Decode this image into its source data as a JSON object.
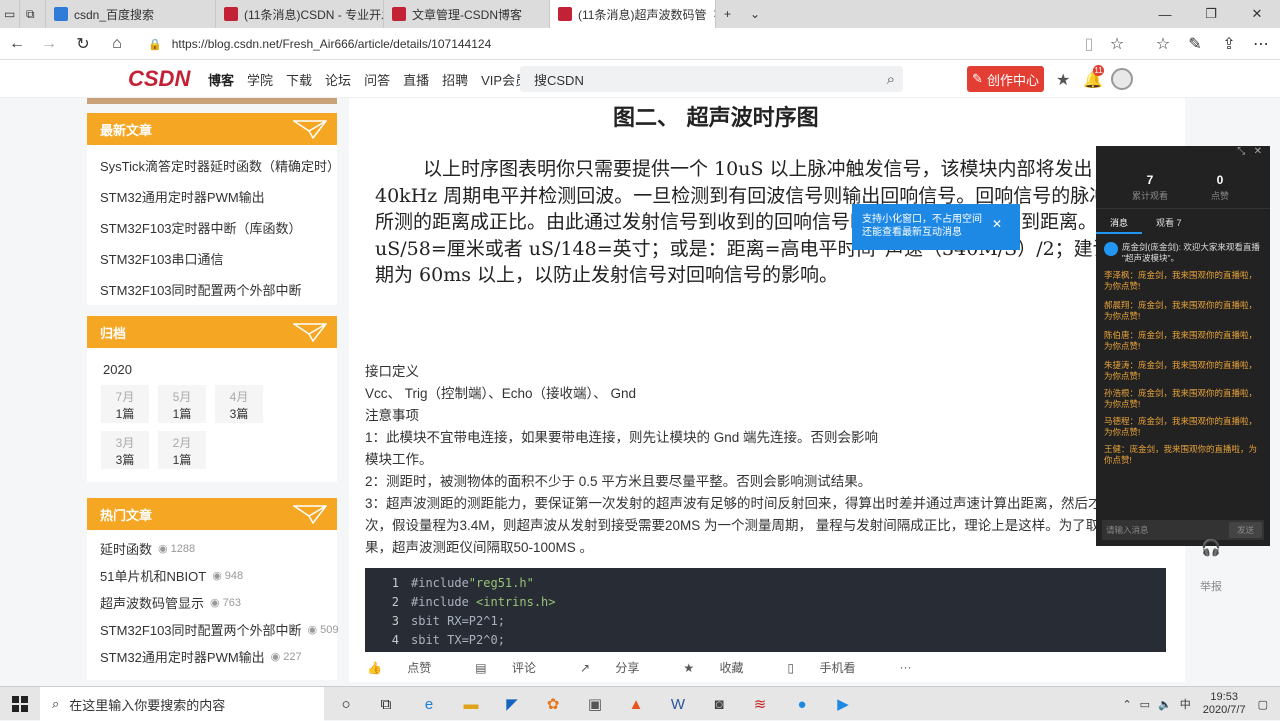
{
  "browser": {
    "tabs": [
      {
        "label": "csdn_百度搜索",
        "icon": "baidu"
      },
      {
        "label": "(11条消息)CSDN - 专业开发",
        "icon": "csdn"
      },
      {
        "label": "文章管理-CSDN博客",
        "icon": "csdn"
      },
      {
        "label": "(11条消息)超声波数码管",
        "icon": "csdn"
      }
    ],
    "url": "https://blog.csdn.net/Fresh_Air666/article/details/107144124"
  },
  "header": {
    "logo": "CSDN",
    "nav": [
      "博客",
      "学院",
      "下载",
      "论坛",
      "问答",
      "直播",
      "招聘",
      "VIP会员"
    ],
    "search_text": "搜CSDN",
    "create_label": "创作中心",
    "notif_count": "11",
    "accent": "#c32136"
  },
  "sidebar": {
    "latest_title": "最新文章",
    "latest": [
      "SysTick滴答定时器延时函数（精确定时）",
      "STM32通用定时器PWM输出",
      "STM32F103定时器中断（库函数）",
      "STM32F103串口通信",
      "STM32F103同时配置两个外部中断"
    ],
    "archive_title": "归档",
    "archive_year": "2020",
    "archive": [
      {
        "m": "7月",
        "c": "1篇"
      },
      {
        "m": "5月",
        "c": "1篇"
      },
      {
        "m": "4月",
        "c": "3篇"
      },
      {
        "m": "3月",
        "c": "3篇"
      },
      {
        "m": "2月",
        "c": "1篇"
      }
    ],
    "hot_title": "热门文章",
    "hot": [
      {
        "t": "延时函数",
        "v": "1288"
      },
      {
        "t": "51单片机和NBIOT",
        "v": "948"
      },
      {
        "t": "超声波数码管显示",
        "v": "763"
      },
      {
        "t": "STM32F103同时配置两个外部中断",
        "v": "509"
      },
      {
        "t": "STM32通用定时器PWM输出",
        "v": "227"
      }
    ]
  },
  "article": {
    "fig_title": "图二、 超声波时序图",
    "fig_para": "以上时序图表明你只需要提供一个 10uS 以上脉冲触发信号，该模块内部将发出 8 个 40kHz 周期电平并检测回波。一旦检测到有回波信号则输出回响信号。回响信号的脉冲宽度与所测的距离成正比。由此通过发射信号到收到的回响信号时间间隔可以计算得到距离。公式：uS/58=厘米或者 uS/148=英寸；或是：距离=高电平时间*声速（340M/S）/2；建议测量周期为 60ms 以上，以防止发射信号对回响信号的影响。",
    "lines": [
      "接口定义",
      "Vcc、 Trig（控制端）、Echo（接收端）、 Gnd",
      "注意事项",
      "1：此模块不宜带电连接，如果要带电连接，则先让模块的 Gnd 端先连接。否则会影响",
      "模块工作。",
      "2：测距时，被测物体的面积不少于 0.5 平方米且要尽量平整。否则会影响测试结果。",
      "3：超声波测距的测距能力，要保证第一次发射的超声波有足够的时间反射回来，得算出时差并通过声速计算出距离，然后才能",
      "次，假设量程为3.4M，则超声波从发射到接受需要20MS 为一个测量周期， 量程与发射间隔成正比，理论上是这样。为了取得",
      "果，超声波测距仪间隔取50-100MS 。"
    ],
    "code": [
      {
        "n": "1",
        "pre": "#include",
        "str": "\"reg51.h\""
      },
      {
        "n": "2",
        "pre": "#include ",
        "str": "<intrins.h>"
      },
      {
        "n": "3",
        "pre": "sbit RX=P2^1;",
        "str": ""
      },
      {
        "n": "4",
        "pre": "sbit TX=P2^0;",
        "str": ""
      }
    ]
  },
  "toolbar": [
    "点赞",
    "评论",
    "分享",
    "收藏",
    "手机看",
    "···"
  ],
  "tooltip": {
    "text": "支持小化窗口，不占用空间还能查看最新互动消息"
  },
  "live": {
    "views": "7",
    "views_label": "累计观看",
    "likes": "0",
    "likes_label": "点赞",
    "tab_msg": "消息",
    "tab_viewers": "观看 7",
    "system_msg": "庞金剑(庞金剑): 欢迎大家来观看直播 \"超声波模块\"。",
    "messages": [
      "李泽枫：庞金剑，我来围观你的直播啦，为你点赞!",
      "郝晨翔：庞金剑，我来围观你的直播啦，为你点赞!",
      "陈伯唐：庞金剑，我来围观你的直播啦，为你点赞!",
      "朱捷涛：庞金剑，我来围观你的直播啦，为你点赞!",
      "孙浩根：庞金剑，我来围观你的直播啦，为你点赞!",
      "马德程：庞金剑，我来围观你的直播啦，为你点赞!",
      "王健：庞金剑，我来围观你的直播啦，为你点赞!"
    ],
    "input_placeholder": "请输入消息",
    "send": "发送",
    "report": "举报"
  },
  "taskbar": {
    "search_placeholder": "在这里输入你要搜索的内容",
    "ime": "中",
    "time": "19:53",
    "date": "2020/7/7"
  }
}
